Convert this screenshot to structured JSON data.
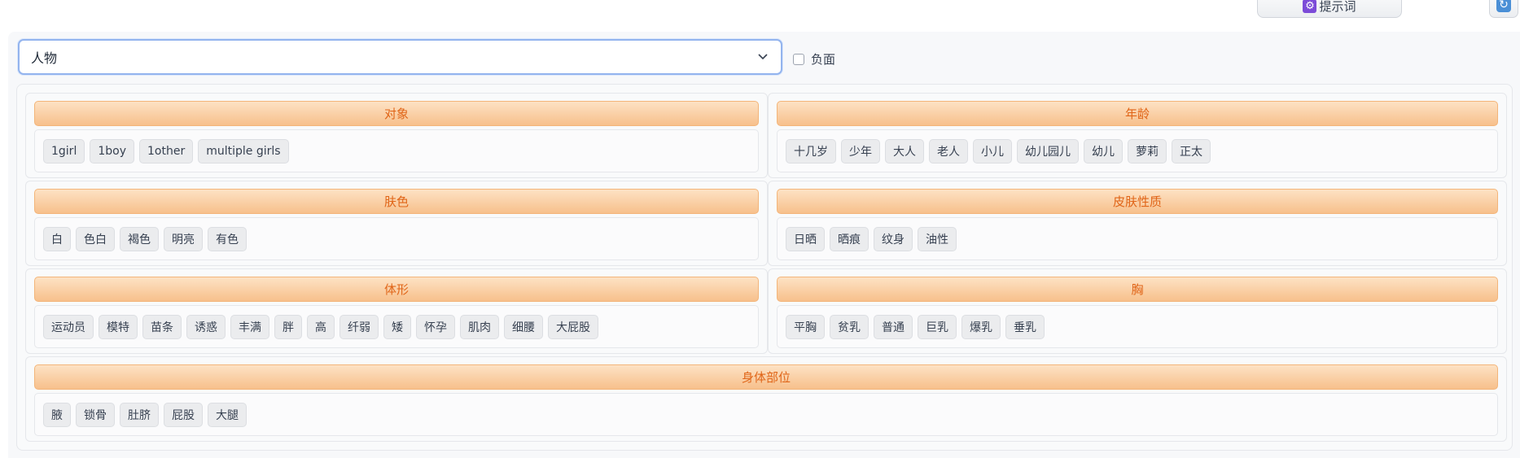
{
  "toolbar": {
    "prompt_icon": "purple-gear-icon",
    "prompt_label": "提示词",
    "refresh_icon": "refresh-icon"
  },
  "category_select": {
    "value": "人物"
  },
  "negative_checkbox": {
    "label": "负面",
    "checked": false
  },
  "colors": {
    "header_text": "#e06518",
    "header_gradient_top": "#fde2c4",
    "header_gradient_bottom": "#f7c08c",
    "select_border": "#93b4ee"
  },
  "groups": [
    {
      "title": "对象",
      "tags": [
        "1girl",
        "1boy",
        "1other",
        "multiple girls"
      ]
    },
    {
      "title": "年龄",
      "tags": [
        "十几岁",
        "少年",
        "大人",
        "老人",
        "小儿",
        "幼儿园儿",
        "幼儿",
        "萝莉",
        "正太"
      ]
    },
    {
      "title": "肤色",
      "tags": [
        "白",
        "色白",
        "褐色",
        "明亮",
        "有色"
      ]
    },
    {
      "title": "皮肤性质",
      "tags": [
        "日晒",
        "晒痕",
        "纹身",
        "油性"
      ]
    },
    {
      "title": "体形",
      "tags": [
        "运动员",
        "模特",
        "苗条",
        "诱惑",
        "丰满",
        "胖",
        "高",
        "纤弱",
        "矮",
        "怀孕",
        "肌肉",
        "细腰",
        "大屁股"
      ]
    },
    {
      "title": "胸",
      "tags": [
        "平胸",
        "贫乳",
        "普通",
        "巨乳",
        "爆乳",
        "垂乳"
      ]
    },
    {
      "title": "身体部位",
      "tags": [
        "腋",
        "锁骨",
        "肚脐",
        "屁股",
        "大腿"
      ]
    }
  ]
}
